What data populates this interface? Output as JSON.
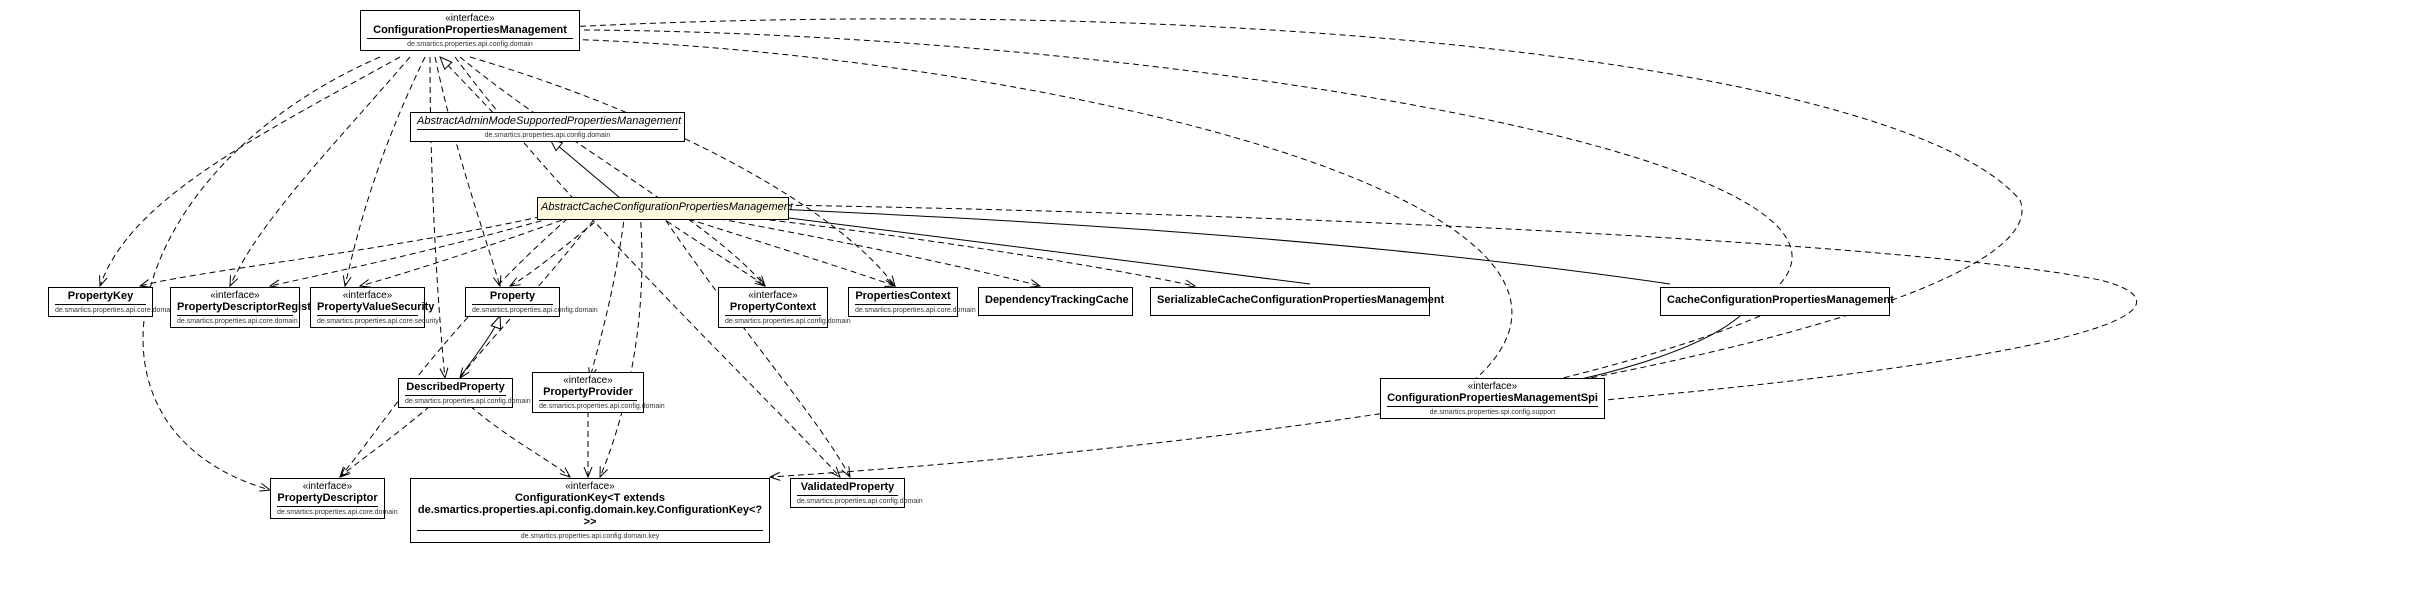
{
  "stereotype_interface": "«interface»",
  "nodes": {
    "cpm": {
      "title": "ConfigurationPropertiesManagement",
      "pkg": "de.smartics.properties.api.config.domain"
    },
    "amspm": {
      "title": "AbstractAdminModeSupportedPropertiesManagement",
      "pkg": "de.smartics.properties.api.config.domain"
    },
    "accpm": {
      "title": "AbstractCacheConfigurationPropertiesManagement",
      "pkg": ""
    },
    "pkey": {
      "title": "PropertyKey",
      "pkg": "de.smartics.properties.api.core.domain"
    },
    "pdr": {
      "title": "PropertyDescriptorRegistry",
      "pkg": "de.smartics.properties.api.core.domain"
    },
    "pvs": {
      "title": "PropertyValueSecurity",
      "pkg": "de.smartics.properties.api.core.security"
    },
    "prop": {
      "title": "Property",
      "pkg": "de.smartics.properties.api.config.domain"
    },
    "pctx": {
      "title": "PropertyContext",
      "pkg": "de.smartics.properties.api.config.domain"
    },
    "psctx": {
      "title": "PropertiesContext",
      "pkg": "de.smartics.properties.api.core.domain"
    },
    "dtc": {
      "title": "DependencyTrackingCache",
      "pkg": ""
    },
    "sccpm": {
      "title": "SerializableCacheConfigurationPropertiesManagement",
      "pkg": ""
    },
    "ccpm": {
      "title": "CacheConfigurationPropertiesManagement",
      "pkg": ""
    },
    "dprop": {
      "title": "DescribedProperty",
      "pkg": "de.smartics.properties.api.config.domain"
    },
    "pprov": {
      "title": "PropertyProvider",
      "pkg": "de.smartics.properties.api.config.domain"
    },
    "pd": {
      "title": "PropertyDescriptor",
      "pkg": "de.smartics.properties.api.core.domain"
    },
    "ck": {
      "title": "ConfigurationKey<T extends de.smartics.properties.api.config.domain.key.ConfigurationKey<?>>",
      "pkg": "de.smartics.properties.api.config.domain.key"
    },
    "vprop": {
      "title": "ValidatedProperty",
      "pkg": "de.smartics.properties.api.config.domain"
    },
    "cpms": {
      "title": "ConfigurationPropertiesManagementSpi",
      "pkg": "de.smartics.properties.spi.config.support"
    }
  }
}
